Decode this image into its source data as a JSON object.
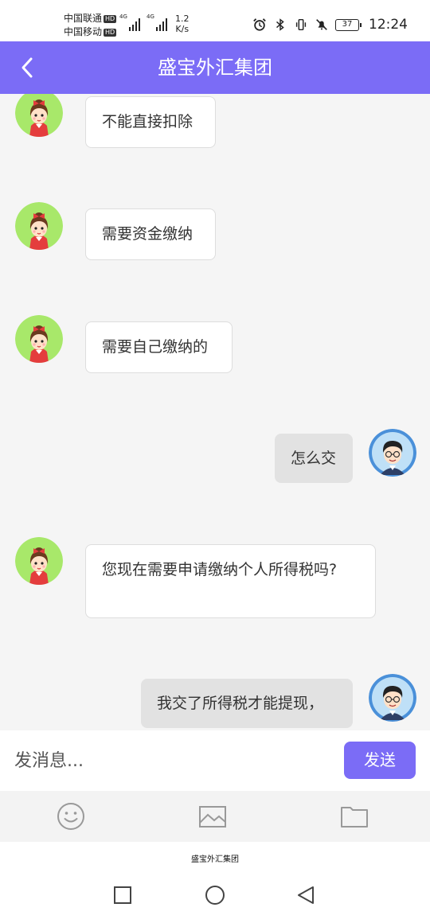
{
  "status_bar": {
    "carrier1": "中国联通",
    "carrier2": "中国移动",
    "hd_label": "HD",
    "net1": "4G",
    "net2": "4G",
    "speed_value": "1.2",
    "speed_unit": "K/s",
    "battery": "37",
    "time": "12:24"
  },
  "header": {
    "title": "盛宝外汇集团",
    "back_icon": "chevron-left-icon"
  },
  "messages": [
    {
      "side": "left",
      "text": "不能直接扣除"
    },
    {
      "side": "left",
      "text": "需要资金缴纳"
    },
    {
      "side": "left",
      "text": "需要自己缴纳的"
    },
    {
      "side": "right",
      "text": "怎么交"
    },
    {
      "side": "left",
      "text": "您现在需要申请缴纳个人所得税吗?"
    },
    {
      "side": "right",
      "text": "我交了所得税才能提现，"
    }
  ],
  "input": {
    "placeholder": "发消息...",
    "value": "",
    "send_label": "发送"
  },
  "tools": [
    "emoji-icon",
    "image-icon",
    "folder-icon"
  ],
  "bottom": {
    "app_label": "盛宝外汇集团",
    "nav": [
      "recent-apps-icon",
      "home-icon",
      "back-icon"
    ]
  },
  "colors": {
    "accent": "#7b6cf6",
    "bubble_left": "#ffffff",
    "bubble_right": "#e2e2e2",
    "background": "#f5f5f5"
  }
}
